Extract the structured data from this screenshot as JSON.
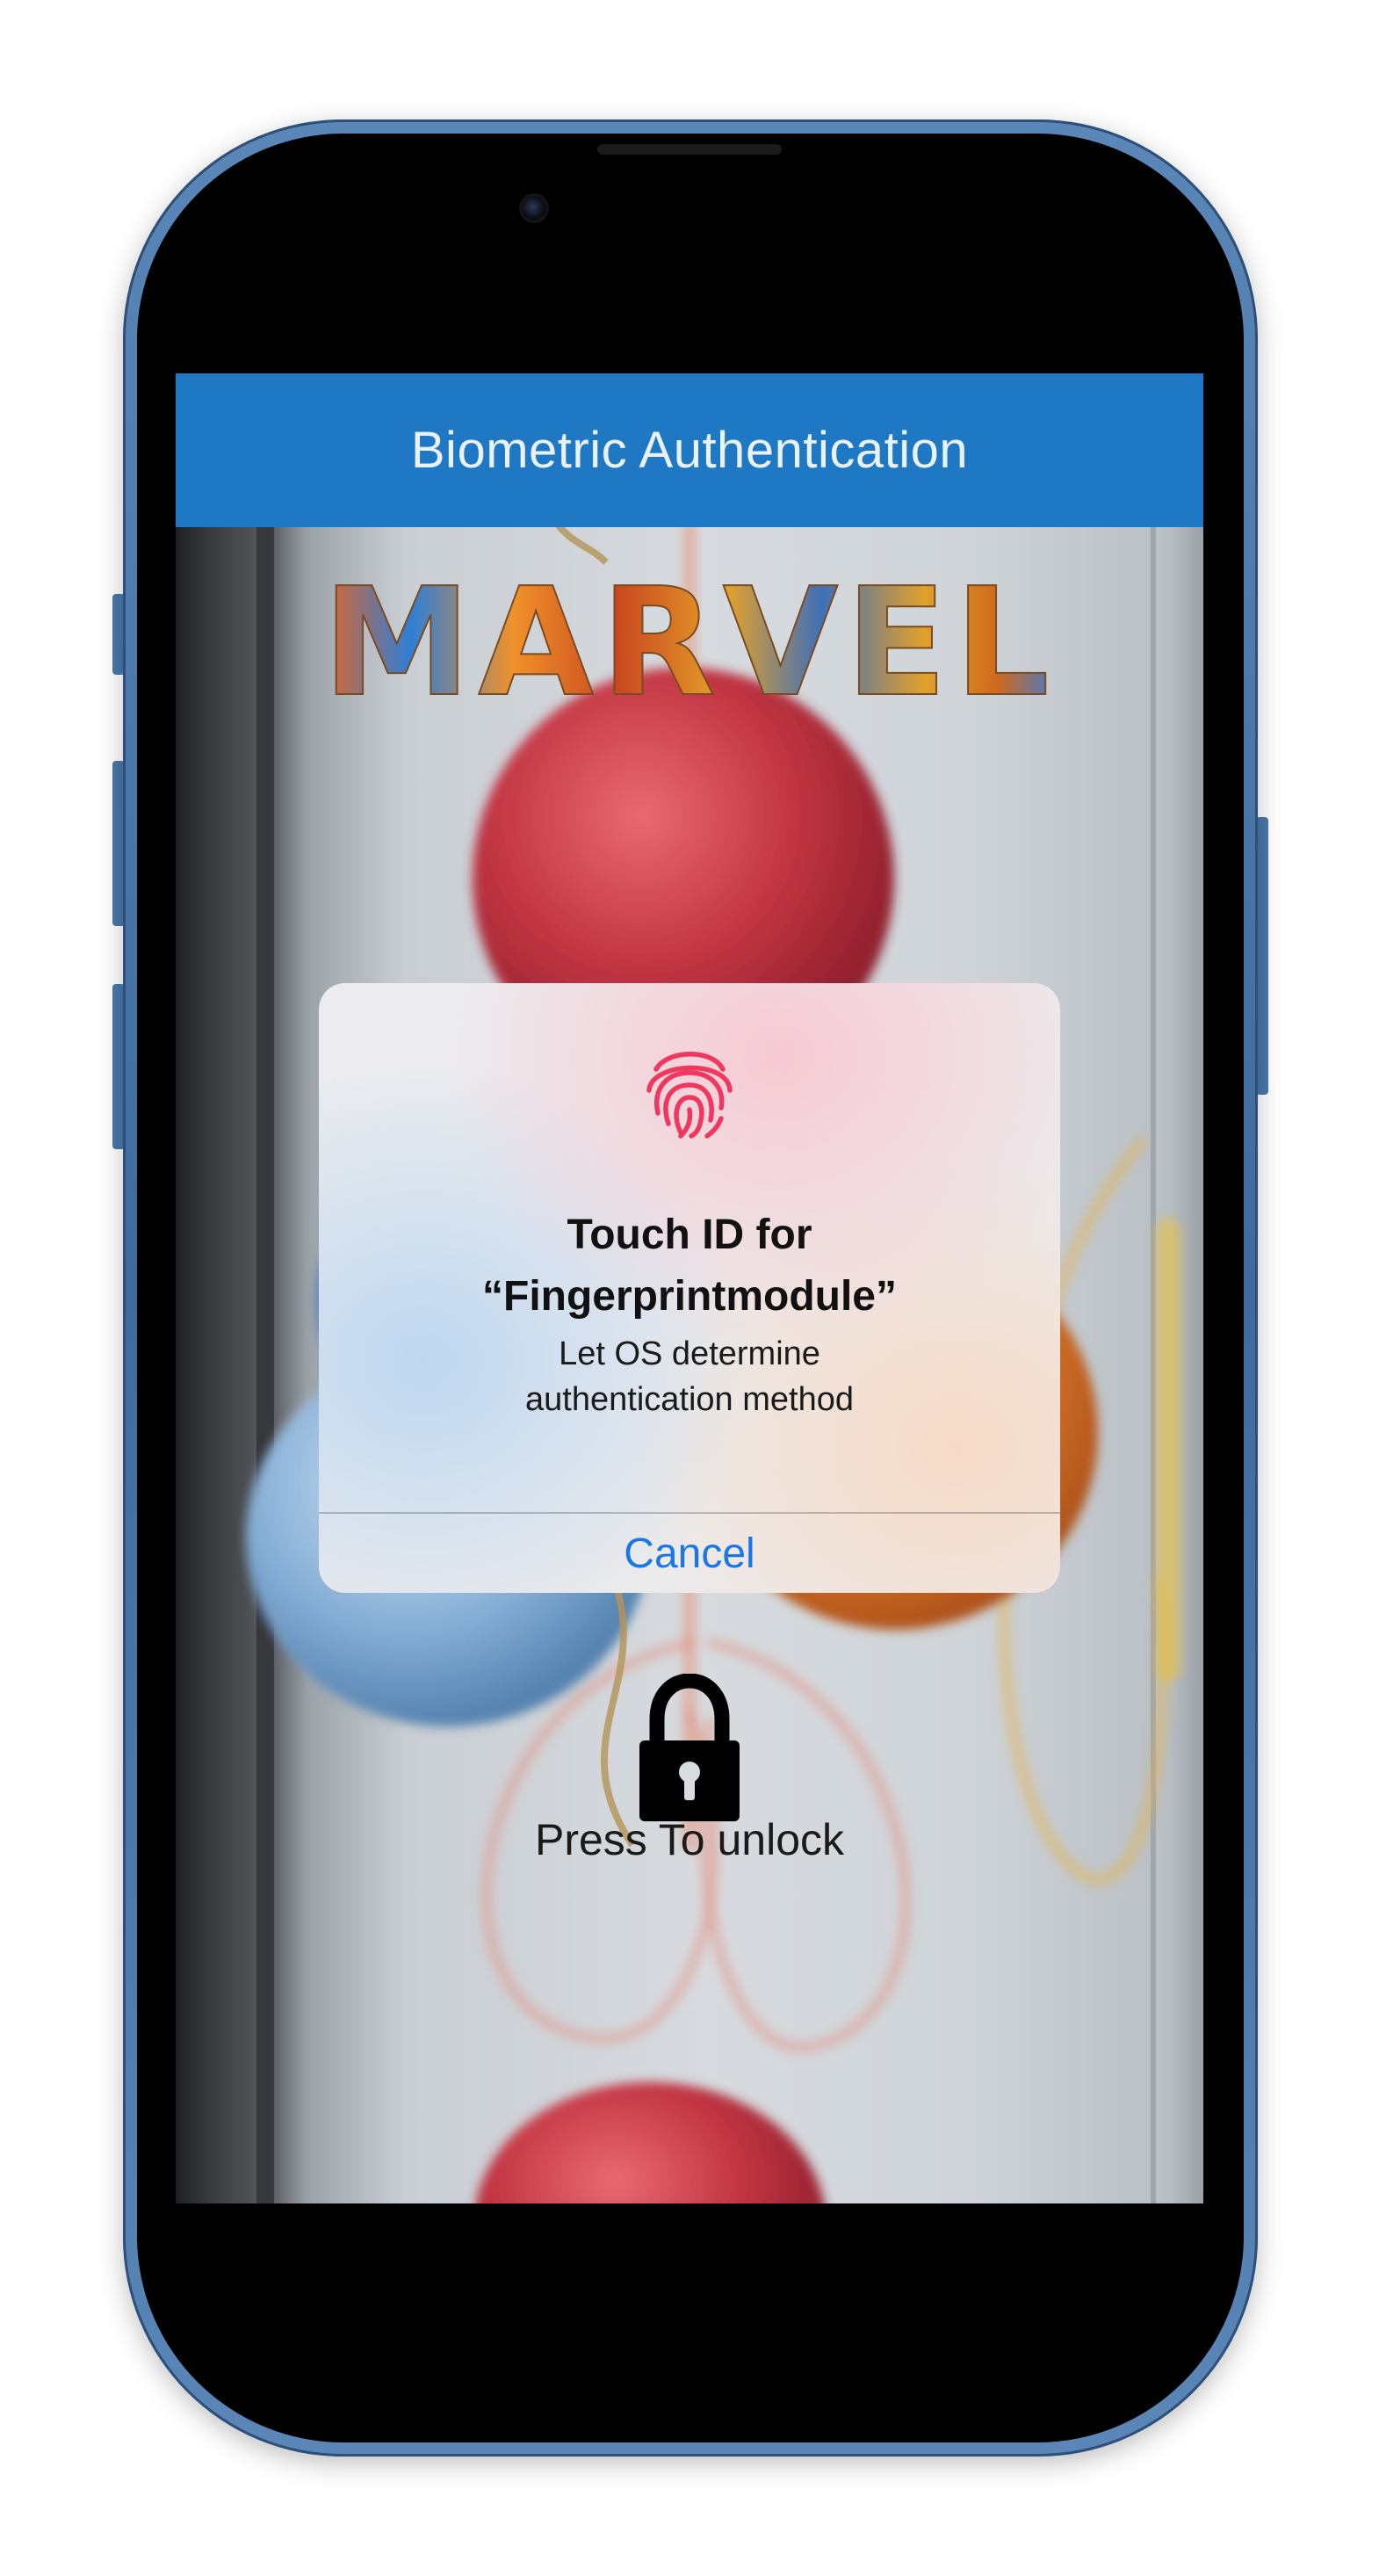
{
  "app": {
    "navbar_title": "Biometric Authentication",
    "logo_text": "MARVEL",
    "unlock_label": "Press To unlock"
  },
  "dialog": {
    "title_line1": "Touch ID for",
    "title_line2": "“Fingerprintmodule”",
    "subtitle_line1": "Let OS determine",
    "subtitle_line2": "authentication method",
    "cancel_label": "Cancel",
    "icon": "fingerprint-icon"
  },
  "colors": {
    "navbar": "#1e78c3",
    "cancel": "#1a78e6",
    "fingerprint": "#f0375f"
  }
}
